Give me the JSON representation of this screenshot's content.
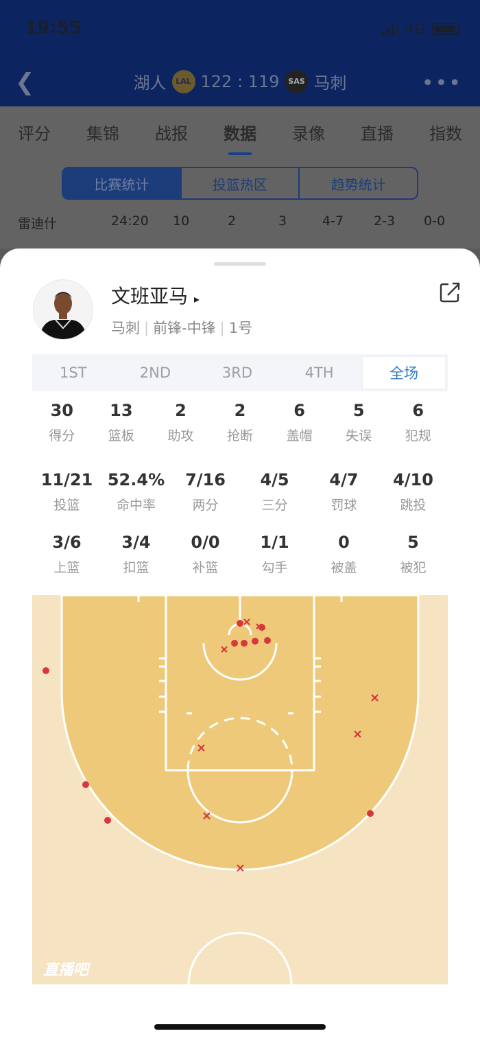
{
  "status": {
    "time": "19:55",
    "network": "4G"
  },
  "header": {
    "home_team": "湖人",
    "home_logo": "LAL",
    "score": "122 : 119",
    "away_logo": "SAS",
    "away_team": "马刺"
  },
  "tabs": [
    "评分",
    "集锦",
    "战报",
    "数据",
    "录像",
    "直播",
    "指数"
  ],
  "segments": [
    "比赛统计",
    "投篮热区",
    "趋势统计"
  ],
  "bg_row": [
    "雷迪什",
    "24:20",
    "10",
    "2",
    "3",
    "4-7",
    "2-3",
    "0-0"
  ],
  "player": {
    "name": "文班亚马",
    "arrow": "▸",
    "team": "马刺",
    "position": "前锋-中锋",
    "number": "1号"
  },
  "quarters": [
    "1ST",
    "2ND",
    "3RD",
    "4TH",
    "全场"
  ],
  "stats_row1": [
    {
      "v": "30",
      "l": "得分"
    },
    {
      "v": "13",
      "l": "篮板"
    },
    {
      "v": "2",
      "l": "助攻"
    },
    {
      "v": "2",
      "l": "抢断"
    },
    {
      "v": "6",
      "l": "盖帽"
    },
    {
      "v": "5",
      "l": "失误"
    },
    {
      "v": "6",
      "l": "犯规"
    }
  ],
  "stats_row2": [
    {
      "v": "11/21",
      "l": "投篮"
    },
    {
      "v": "52.4%",
      "l": "命中率"
    },
    {
      "v": "7/16",
      "l": "两分"
    },
    {
      "v": "4/5",
      "l": "三分"
    },
    {
      "v": "4/7",
      "l": "罚球"
    },
    {
      "v": "4/10",
      "l": "跳投"
    }
  ],
  "stats_row3": [
    {
      "v": "3/6",
      "l": "上篮"
    },
    {
      "v": "3/4",
      "l": "扣篮"
    },
    {
      "v": "0/0",
      "l": "补篮"
    },
    {
      "v": "1/1",
      "l": "勾手"
    },
    {
      "v": "0",
      "l": "被盖"
    },
    {
      "v": "5",
      "l": "被犯"
    }
  ],
  "court": {
    "watermark": "直播吧"
  },
  "colors": {
    "accent": "#2f78c8",
    "made": "#d9363e",
    "missed": "#d9363e",
    "court_inner": "#eec97a",
    "court_outer": "#f5e3c1"
  },
  "icons": {
    "back": "chevron-left-icon",
    "more": "more-dots-icon",
    "share": "share-icon"
  }
}
